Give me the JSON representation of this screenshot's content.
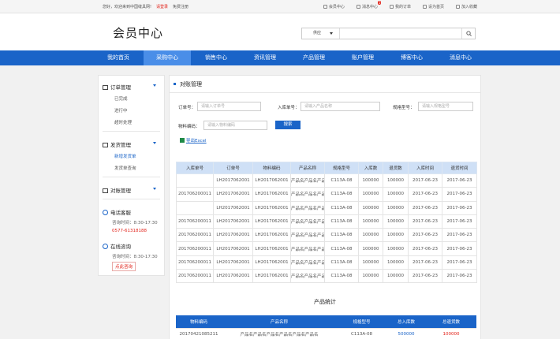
{
  "topbar": {
    "greeting": "您好，欢迎来到中国缝具网!",
    "login": "请登录",
    "register": "免费注册",
    "links": [
      "会员中心",
      "消息中心",
      "我的订单",
      "设为首页",
      "加入收藏"
    ],
    "message_badge": "5"
  },
  "header": {
    "logo": "会员中心",
    "search_select": "供应",
    "search_placeholder": ""
  },
  "nav": {
    "items": [
      "我的首页",
      "采购中心",
      "销售中心",
      "资讯管理",
      "产品管理",
      "账户管理",
      "博客中心",
      "消息中心"
    ],
    "active": "采购中心"
  },
  "sidebar": {
    "groups": [
      {
        "title": "订单管理",
        "items": [
          "已完成",
          "进行中",
          "超时处理"
        ]
      },
      {
        "title": "发货管理",
        "items": [
          "新增发货单",
          "发货单查询"
        ]
      },
      {
        "title": "对账管理",
        "items": []
      }
    ],
    "active_item": "新增发货单",
    "phone": {
      "title": "电话客服",
      "hours": "咨询时间：8:30-17:30",
      "number": "0577-61318188"
    },
    "online": {
      "title": "在线咨询",
      "hours": "咨询时间：8:30-17:30",
      "button": "点此咨询"
    }
  },
  "main": {
    "title": "对账管理",
    "filters": {
      "order_no": {
        "label": "订单号：",
        "placeholder": "请输入订单号"
      },
      "stock_no": {
        "label": "入库单号：",
        "placeholder": "请输入产品名称"
      },
      "spec_no": {
        "label": "规格型号：",
        "placeholder": "请输入规格型号"
      },
      "material_code": {
        "label": "物料编码：",
        "placeholder": "请输入物料编码"
      },
      "search_button": "搜索"
    },
    "export": "导出Excel",
    "table": {
      "headers": [
        "入库单号",
        "订单号",
        "物料编码",
        "产品名称",
        "规格型号",
        "入库数",
        "退货数",
        "入库时间",
        "退货时间"
      ],
      "rows": [
        [
          "",
          "LH2017062001",
          "LH2017062001",
          "产品名产品名产品",
          "C113A-08",
          "100000",
          "100000",
          "2017-06-23",
          "2017-06-23"
        ],
        [
          "201706200011",
          "LH2017062001",
          "LH2017062001",
          "产品名产品名产品",
          "C113A-08",
          "100000",
          "100000",
          "2017-06-23",
          "2017-06-23"
        ],
        [
          "",
          "LH2017062001",
          "LH2017062001",
          "产品名产品名产品",
          "C113A-08",
          "100000",
          "100000",
          "2017-06-23",
          "2017-06-23"
        ],
        [
          "201706200011",
          "LH2017062001",
          "LH2017062001",
          "产品名产品名产品",
          "C113A-08",
          "100000",
          "100000",
          "2017-06-23",
          "2017-06-23"
        ],
        [
          "201706200011",
          "LH2017062001",
          "LH2017062001",
          "产品名产品名产品",
          "C113A-08",
          "100000",
          "100000",
          "2017-06-23",
          "2017-06-23"
        ],
        [
          "201706200011",
          "LH2017062001",
          "LH2017062001",
          "产品名产品名产品",
          "C113A-08",
          "100000",
          "100000",
          "2017-06-23",
          "2017-06-23"
        ],
        [
          "201706200011",
          "LH2017062001",
          "LH2017062001",
          "产品名产品名产品",
          "C113A-08",
          "100000",
          "100000",
          "2017-06-23",
          "2017-06-23"
        ],
        [
          "201706200011",
          "LH2017062001",
          "LH2017062001",
          "产品名产品名产品",
          "C113A-08",
          "100000",
          "100000",
          "2017-06-23",
          "2017-06-23"
        ]
      ]
    },
    "stats_title": "产品统计",
    "stats_table": {
      "headers": [
        "物料编码",
        "产品名称",
        "规格型号",
        "总入库数",
        "总退货数"
      ],
      "rows": [
        [
          "20170421085211",
          "产品名产品名产品名产品名产品名产品名",
          "C113A-08",
          "500000",
          "100000"
        ]
      ]
    }
  },
  "colors": {
    "brand": "#1a64c8",
    "nav_active": "#4a8ee8",
    "accent_red": "#e2231a"
  }
}
